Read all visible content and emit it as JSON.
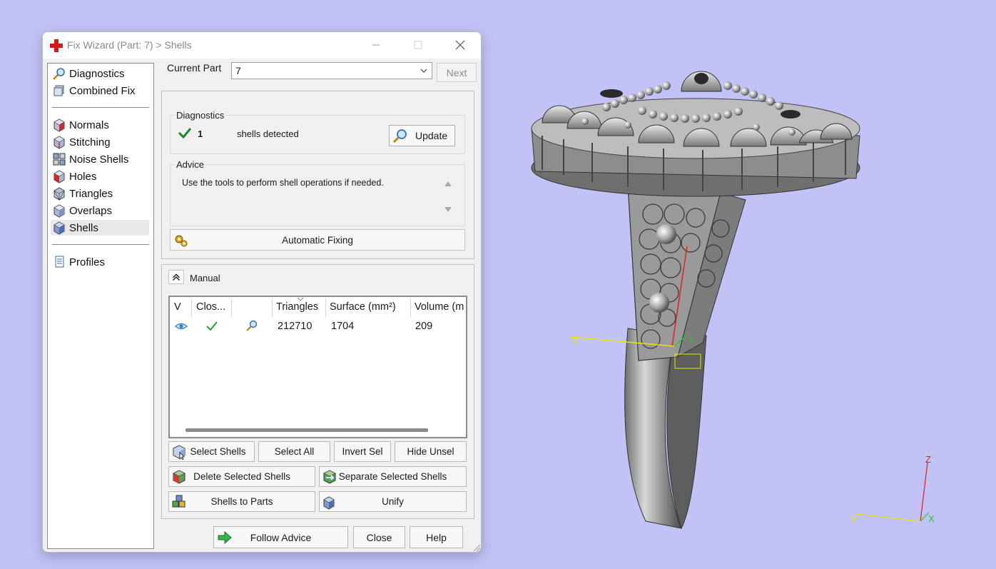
{
  "window": {
    "title": "Fix Wizard (Part: 7) > Shells"
  },
  "sidebar": {
    "items": [
      {
        "label": "Diagnostics",
        "icon": "magnifier-icon"
      },
      {
        "label": "Combined Fix",
        "icon": "cube-stack-icon"
      },
      {
        "label": "Normals",
        "icon": "normals-cube-icon"
      },
      {
        "label": "Stitching",
        "icon": "stitching-cube-icon"
      },
      {
        "label": "Noise Shells",
        "icon": "noise-shells-icon"
      },
      {
        "label": "Holes",
        "icon": "holes-cube-icon"
      },
      {
        "label": "Triangles",
        "icon": "triangles-cube-icon"
      },
      {
        "label": "Overlaps",
        "icon": "overlaps-cube-icon"
      },
      {
        "label": "Shells",
        "icon": "shells-cube-icon",
        "selected": true
      },
      {
        "label": "Profiles",
        "icon": "document-icon"
      }
    ]
  },
  "current_part": {
    "label": "Current Part",
    "value": "7",
    "next_label": "Next"
  },
  "diagnostics": {
    "title": "Diagnostics",
    "count": "1",
    "text": "shells detected",
    "update_label": "Update"
  },
  "advice": {
    "title": "Advice",
    "text": "Use the tools to perform shell operations if needed."
  },
  "automatic_fixing_label": "Automatic Fixing",
  "manual": {
    "title": "Manual",
    "table": {
      "columns": [
        "V",
        "Clos...",
        "",
        "Triangles",
        "Surface (mm²)",
        "Volume (m"
      ],
      "rows": [
        {
          "visible_icon": "eye-icon",
          "closed_icon": "check-icon",
          "tool_icon": "magnifier-icon",
          "triangles": "212710",
          "surface": "1704",
          "volume": "209"
        }
      ]
    },
    "buttons": {
      "select_shells": "Select Shells",
      "select_all": "Select All",
      "invert_sel": "Invert Sel",
      "hide_unsel": "Hide Unsel",
      "delete_selected": "Delete Selected Shells",
      "separate_selected": "Separate Selected Shells",
      "shells_to_parts": "Shells to Parts",
      "unify": "Unify"
    }
  },
  "footer": {
    "follow_advice": "Follow Advice",
    "close": "Close",
    "help": "Help"
  },
  "viewport": {
    "axis_labels": {
      "x": "X",
      "y": "Y",
      "z": "Z"
    },
    "background": "#c2c2f6"
  }
}
